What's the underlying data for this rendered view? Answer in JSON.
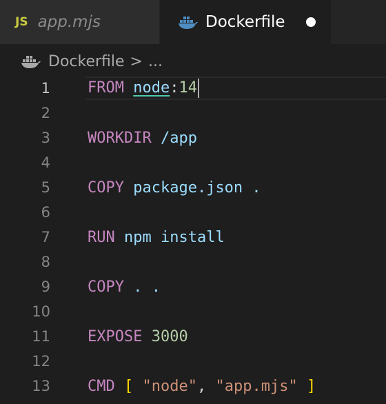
{
  "colors": {
    "keyword": "#c586c0",
    "identifier": "#9cdcfe",
    "string": "#ce9178",
    "number": "#b5cea8",
    "bracket": "#ffd700",
    "js_icon": "#cbcb41",
    "docker_icon": "#4e8ec2"
  },
  "tabs": [
    {
      "icon": "js-file-icon",
      "icon_text": "JS",
      "label": "app.mjs",
      "active": false
    },
    {
      "icon": "docker-icon",
      "label": "Dockerfile",
      "active": true,
      "modified": true
    }
  ],
  "breadcrumb": {
    "icon": "docker-icon",
    "file": "Dockerfile",
    "separator": ">",
    "more": "..."
  },
  "code": {
    "active_line": 1,
    "lines": [
      {
        "number": "1",
        "keyword": "FROM",
        "image": "node",
        "colon": ":",
        "tag": "14"
      },
      {
        "number": "2"
      },
      {
        "number": "3",
        "keyword": "WORKDIR",
        "arg": "/app"
      },
      {
        "number": "4"
      },
      {
        "number": "5",
        "keyword": "COPY",
        "arg": "package.json ."
      },
      {
        "number": "6"
      },
      {
        "number": "7",
        "keyword": "RUN",
        "arg": "npm install"
      },
      {
        "number": "8"
      },
      {
        "number": "9",
        "keyword": "COPY",
        "arg": ". ."
      },
      {
        "number": "10"
      },
      {
        "number": "11",
        "keyword": "EXPOSE",
        "arg": "3000"
      },
      {
        "number": "12"
      },
      {
        "number": "13",
        "keyword": "CMD",
        "open": "[",
        "str1": "\"node\"",
        "comma": ",",
        "str2": "\"app.mjs\"",
        "close": "]"
      }
    ]
  }
}
